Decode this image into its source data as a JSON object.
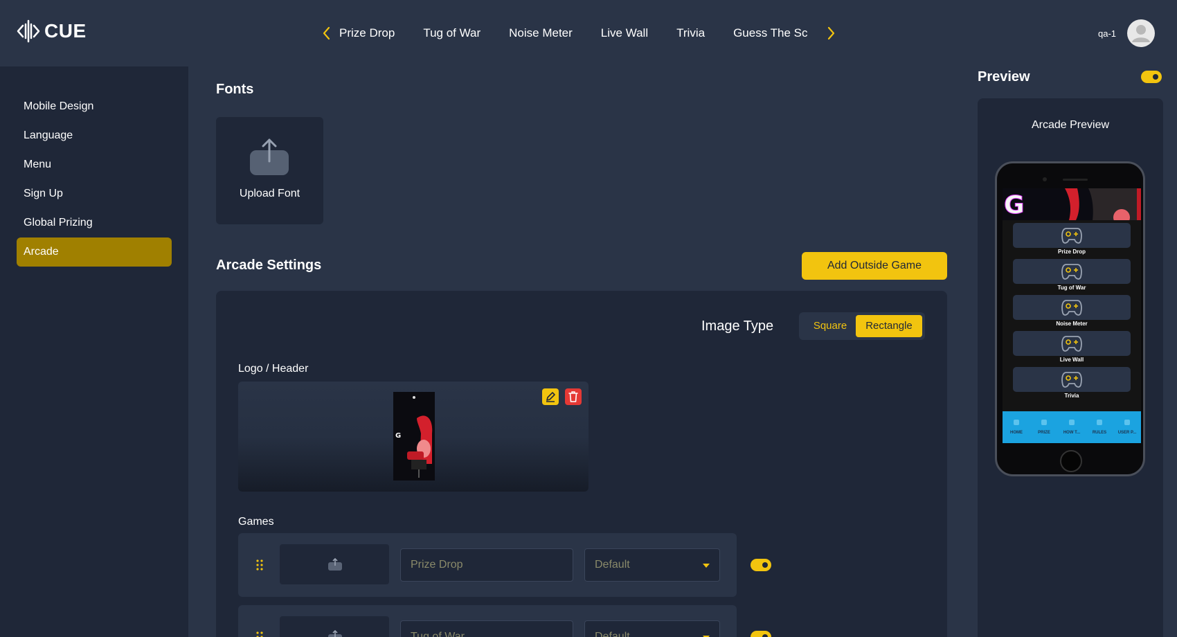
{
  "app": {
    "brand": "CUE"
  },
  "nav": {
    "tabs": [
      "Prize Drop",
      "Tug of War",
      "Noise Meter",
      "Live Wall",
      "Trivia",
      "Guess The Sc"
    ]
  },
  "user": {
    "name": "qa-1"
  },
  "sidebar": {
    "items": [
      {
        "label": "Mobile Design",
        "active": false
      },
      {
        "label": "Language",
        "active": false
      },
      {
        "label": "Menu",
        "active": false
      },
      {
        "label": "Sign Up",
        "active": false
      },
      {
        "label": "Global Prizing",
        "active": false
      },
      {
        "label": "Arcade",
        "active": true
      }
    ]
  },
  "fonts": {
    "heading": "Fonts",
    "upload_label": "Upload Font"
  },
  "arcade": {
    "heading": "Arcade Settings",
    "add_outside_game": "Add Outside Game",
    "image_type": {
      "label": "Image Type",
      "options": [
        "Square",
        "Rectangle"
      ],
      "selected": "Rectangle"
    },
    "logo_header_label": "Logo / Header",
    "games_label": "Games",
    "games": [
      {
        "name_placeholder": "Prize Drop",
        "select_value": "Default",
        "enabled": true
      },
      {
        "name_placeholder": "Tug of War",
        "select_value": "Default",
        "enabled": true
      }
    ]
  },
  "preview": {
    "title": "Preview",
    "enabled": true,
    "card_title": "Arcade Preview",
    "phone_games": [
      "Prize Drop",
      "Tug of War",
      "Noise Meter",
      "Live Wall",
      "Trivia"
    ],
    "footer_items": [
      "HOME",
      "PRIZE",
      "HOW T...",
      "RULES",
      "USER P..."
    ]
  },
  "colors": {
    "accent": "#f2c40f",
    "active_item": "#a08000",
    "background": "#2a3447",
    "panel": "#1f2738",
    "delete": "#e53935",
    "phone_footer": "#1ba3e0"
  }
}
